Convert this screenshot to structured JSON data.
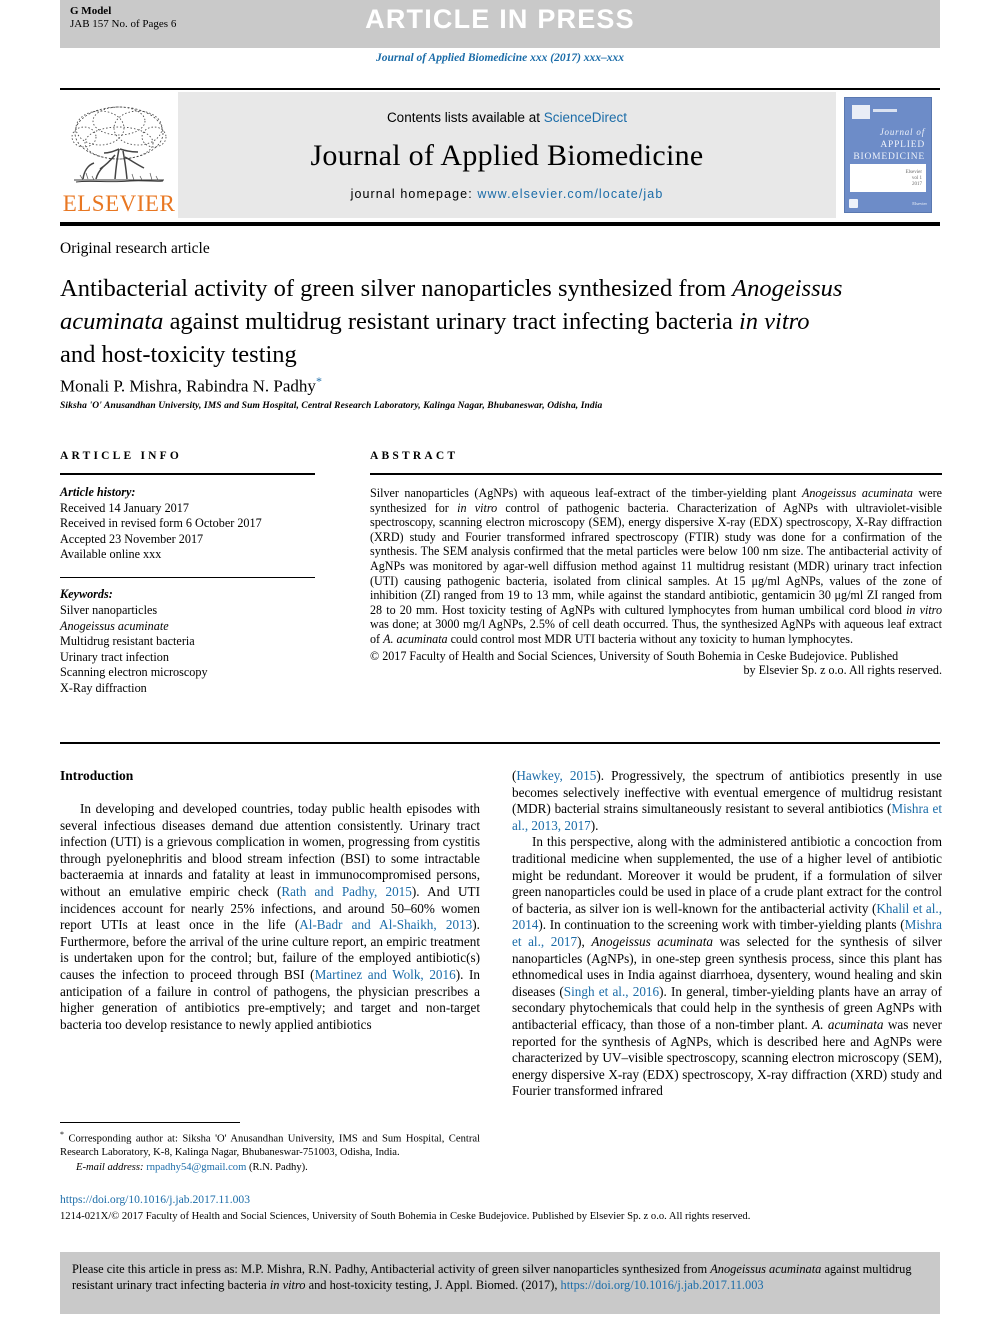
{
  "banner": {
    "model_label": "G Model",
    "model_sub": "JAB 157 No. of Pages 6",
    "title": "ARTICLE IN PRESS"
  },
  "running_head": "Journal of Applied Biomedicine xxx (2017) xxx–xxx",
  "masthead": {
    "publisher_word": "ELSEVIER",
    "contents_prefix": "Contents lists available at ",
    "contents_link": "ScienceDirect",
    "journal_name": "Journal of Applied Biomedicine",
    "homepage_prefix": "journal homepage: ",
    "homepage_url": "www.elsevier.com/locate/jab",
    "cover": {
      "line1": "Journal of",
      "line2": "APPLIED",
      "line3": "BIOMEDICINE",
      "vol_line1": "Elsevier",
      "vol_line2": "vol 1",
      "vol_line3": "2017",
      "publisher": "Elsevier"
    }
  },
  "article": {
    "type": "Original research article",
    "title_line1": "Antibacterial activity of green silver nanoparticles synthesized from",
    "title_italic1": "Anogeissus acuminata",
    "title_line2_rest": " against multidrug resistant urinary tract",
    "title_line3_a": "infecting bacteria ",
    "title_italic2": "in vitro",
    "title_line3_b": " and host-toxicity testing",
    "authors": "Monali P. Mishra, Rabindra N. Padhy",
    "author_marker": "*",
    "affiliation": "Siksha 'O' Anusandhan University, IMS and Sum Hospital, Central Research Laboratory, Kalinga Nagar, Bhubaneswar, Odisha, India"
  },
  "article_info": {
    "heading": "ARTICLE INFO",
    "history_label": "Article history:",
    "history": [
      "Received 14 January 2017",
      "Received in revised form 6 October 2017",
      "Accepted 23 November 2017",
      "Available online xxx"
    ],
    "keywords_label": "Keywords:",
    "keywords": [
      "Silver nanoparticles",
      "Anogeissus acuminate",
      "Multidrug resistant bacteria",
      "Urinary tract infection",
      "Scanning electron microscopy",
      "X-Ray diffraction"
    ],
    "keyword_italic_index": 1
  },
  "abstract": {
    "heading": "ABSTRACT",
    "p1_a": "Silver nanoparticles (AgNPs) with aqueous leaf-extract of the timber-yielding plant ",
    "p1_it1": "Anogeissus acuminata",
    "p1_b": " were synthesized for ",
    "p1_it2": "in vitro",
    "p1_c": " control of pathogenic bacteria. Characterization of AgNPs with ultraviolet-visible spectroscopy, scanning electron microscopy (SEM), energy dispersive X-ray (EDX) spectroscopy, X-Ray diffraction (XRD) study and Fourier transformed infrared spectroscopy (FTIR) study was done for a confirmation of the synthesis. The SEM analysis confirmed that the metal particles were below 100 nm size. The antibacterial activity of AgNPs was monitored by agar-well diffusion method against 11 multidrug resistant (MDR) urinary tract infection (UTI) causing pathogenic bacteria, isolated from clinical samples. At 15 μg/ml AgNPs, values of the zone of inhibition (ZI) ranged from 19 to 13 mm, while against the standard antibiotic, gentamicin 30 μg/ml ZI ranged from 28 to 20 mm. Host toxicity testing of AgNPs with cultured lymphocytes from human umbilical cord blood ",
    "p1_it3": "in vitro",
    "p1_d": " was done; at 3000 mg/l AgNPs, 2.5% of cell death occurred. Thus, the synthesized AgNPs with aqueous leaf extract of ",
    "p1_it4": "A. acuminata",
    "p1_e": " could control most MDR UTI bacteria without any toxicity to human lymphocytes.",
    "copyright_a": "© 2017 Faculty of Health and Social Sciences, University of South Bohemia in Ceske Budejovice. Published",
    "copyright_b": "by Elsevier Sp. z o.o. All rights reserved."
  },
  "body": {
    "intro_heading": "Introduction",
    "left_p1_a": "In developing and developed countries, today public health episodes with several infectious diseases demand due attention consistently. Urinary tract infection (UTI) is a grievous complication in women, progressing from cystitis through pyelonephritis and blood stream infection (BSI) to some intractable bacteraemia at innards and fatality at least in immunocompromised persons, without an emulative empiric check (",
    "left_ref1": "Rath and Padhy, 2015",
    "left_p1_b": "). And UTI incidences account for nearly 25% infections, and around 50–60% women report UTIs at least once in the life (",
    "left_ref2": "Al-Badr and Al-Shaikh, 2013",
    "left_p1_c": "). Furthermore, before the arrival of the urine culture report, an empiric treatment is undertaken upon for the control; but, failure of the employed antibiotic(s) causes the infection to proceed through BSI (",
    "left_ref3": "Martinez and Wolk, 2016",
    "left_p1_d": "). In anticipation of a failure in control of pathogens, the physician prescribes a higher generation of antibiotics pre-emptively; and target and non-target bacteria too develop resistance to newly applied antibiotics",
    "right_ref1": "Hawkey, 2015",
    "right_p1_a": "(",
    "right_p1_b": "). Progressively, the spectrum of antibiotics presently in use becomes selectively ineffective with eventual emergence of multidrug resistant (MDR) bacterial strains simultaneously resistant to several antibiotics (",
    "right_ref2": "Mishra et al., 2013, 2017",
    "right_p1_c": ").",
    "right_p2_a": "In this perspective, along with the administered antibiotic a concoction from traditional medicine when supplemented, the use of a higher level of antibiotic might be redundant. Moreover it would be prudent, if a formulation of silver green nanoparticles could be used in place of a crude plant extract for the control of bacteria, as silver ion is well-known for the antibacterial activity (",
    "right_ref3": "Khalil et al., 2014",
    "right_p2_b": "). In continuation to the screening work with timber-yielding plants (",
    "right_ref4": "Mishra et al., 2017",
    "right_p2_c": "), ",
    "right_it1": "Anogeissus acuminata",
    "right_p2_d": " was selected for the synthesis of silver nanoparticles (AgNPs), in one-step green synthesis process, since this plant has ethnomedical uses in India against diarrhoea, dysentery, wound healing and skin diseases (",
    "right_ref5": "Singh et al., 2016",
    "right_p2_e": "). In general, timber-yielding plants have an array of secondary phytochemicals that could help in the synthesis of green AgNPs with antibacterial efficacy, than those of a non-timber plant. ",
    "right_it2": "A. acuminata",
    "right_p2_f": " was never reported for the synthesis of AgNPs, which is described here and AgNPs were characterized by UV–visible spectroscopy, scanning electron microscopy (SEM), energy dispersive X-ray (EDX) spectroscopy, X-ray diffraction (XRD) study and Fourier transformed infrared"
  },
  "footnote": {
    "marker": "*",
    "text": " Corresponding author at: Siksha 'O' Anusandhan University, IMS and Sum Hospital, Central Research Laboratory, K-8, Kalinga Nagar, Bhubaneswar-751003, Odisha, India.",
    "email_label": "E-mail address:",
    "email": "rnpadhy54@gmail.com",
    "email_suffix": " (R.N. Padhy)."
  },
  "footer": {
    "doi": "https://doi.org/10.1016/j.jab.2017.11.003",
    "issn_line": "1214-021X/© 2017 Faculty of Health and Social Sciences, University of South Bohemia in Ceske Budejovice. Published by Elsevier Sp. z o.o. All rights reserved."
  },
  "citation_box": {
    "a": "Please cite this article in press as: M.P. Mishra, R.N. Padhy, Antibacterial activity of green silver nanoparticles synthesized from ",
    "it1": "Anogeissus acuminata",
    "b": " against multidrug resistant urinary tract infecting bacteria ",
    "it2": "in vitro",
    "c": " and host-toxicity testing, J. Appl. Biomed. (2017), ",
    "link": "https://doi.org/10.1016/j.jab.2017.11.003"
  },
  "colors": {
    "link": "#1b6ca8",
    "banner_bg": "#c9c9c9",
    "masthead_bg": "#e8e8e8",
    "elsevier_orange": "#e87722",
    "cover_blue": "#6d8cc8"
  }
}
